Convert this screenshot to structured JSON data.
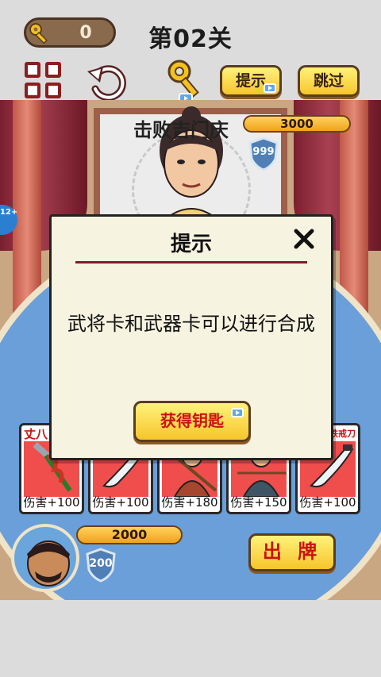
{
  "header": {
    "key_count": "0",
    "level_title": "第02关",
    "hint_label": "提示",
    "skip_label": "跳过"
  },
  "enemy": {
    "name": "击败吉门庆",
    "hp": "3000",
    "armor": "999"
  },
  "age_badge": "12+",
  "cards": [
    {
      "name": "丈八",
      "damage": "伤害+100",
      "icon": "spear-weapon"
    },
    {
      "name": "",
      "damage": "伤害+100",
      "icon": "blade-weapon"
    },
    {
      "name": "",
      "damage": "伤害+180",
      "icon": "general-warrior"
    },
    {
      "name": "",
      "damage": "伤害+150",
      "icon": "general-archer"
    },
    {
      "name": "铁戒刀",
      "damage": "伤害+100",
      "icon": "blade-weapon"
    }
  ],
  "player": {
    "hp": "2000",
    "armor": "200",
    "play_label": "出 牌"
  },
  "dialog": {
    "title": "提示",
    "message": "武将卡和武器卡可以进行合成",
    "button_label": "获得钥匙"
  },
  "colors": {
    "accent_yellow": "#f6c52b",
    "title_red": "#cc1111",
    "curtain": "#7a1f2e",
    "floor_blue": "#6a9fd9"
  }
}
